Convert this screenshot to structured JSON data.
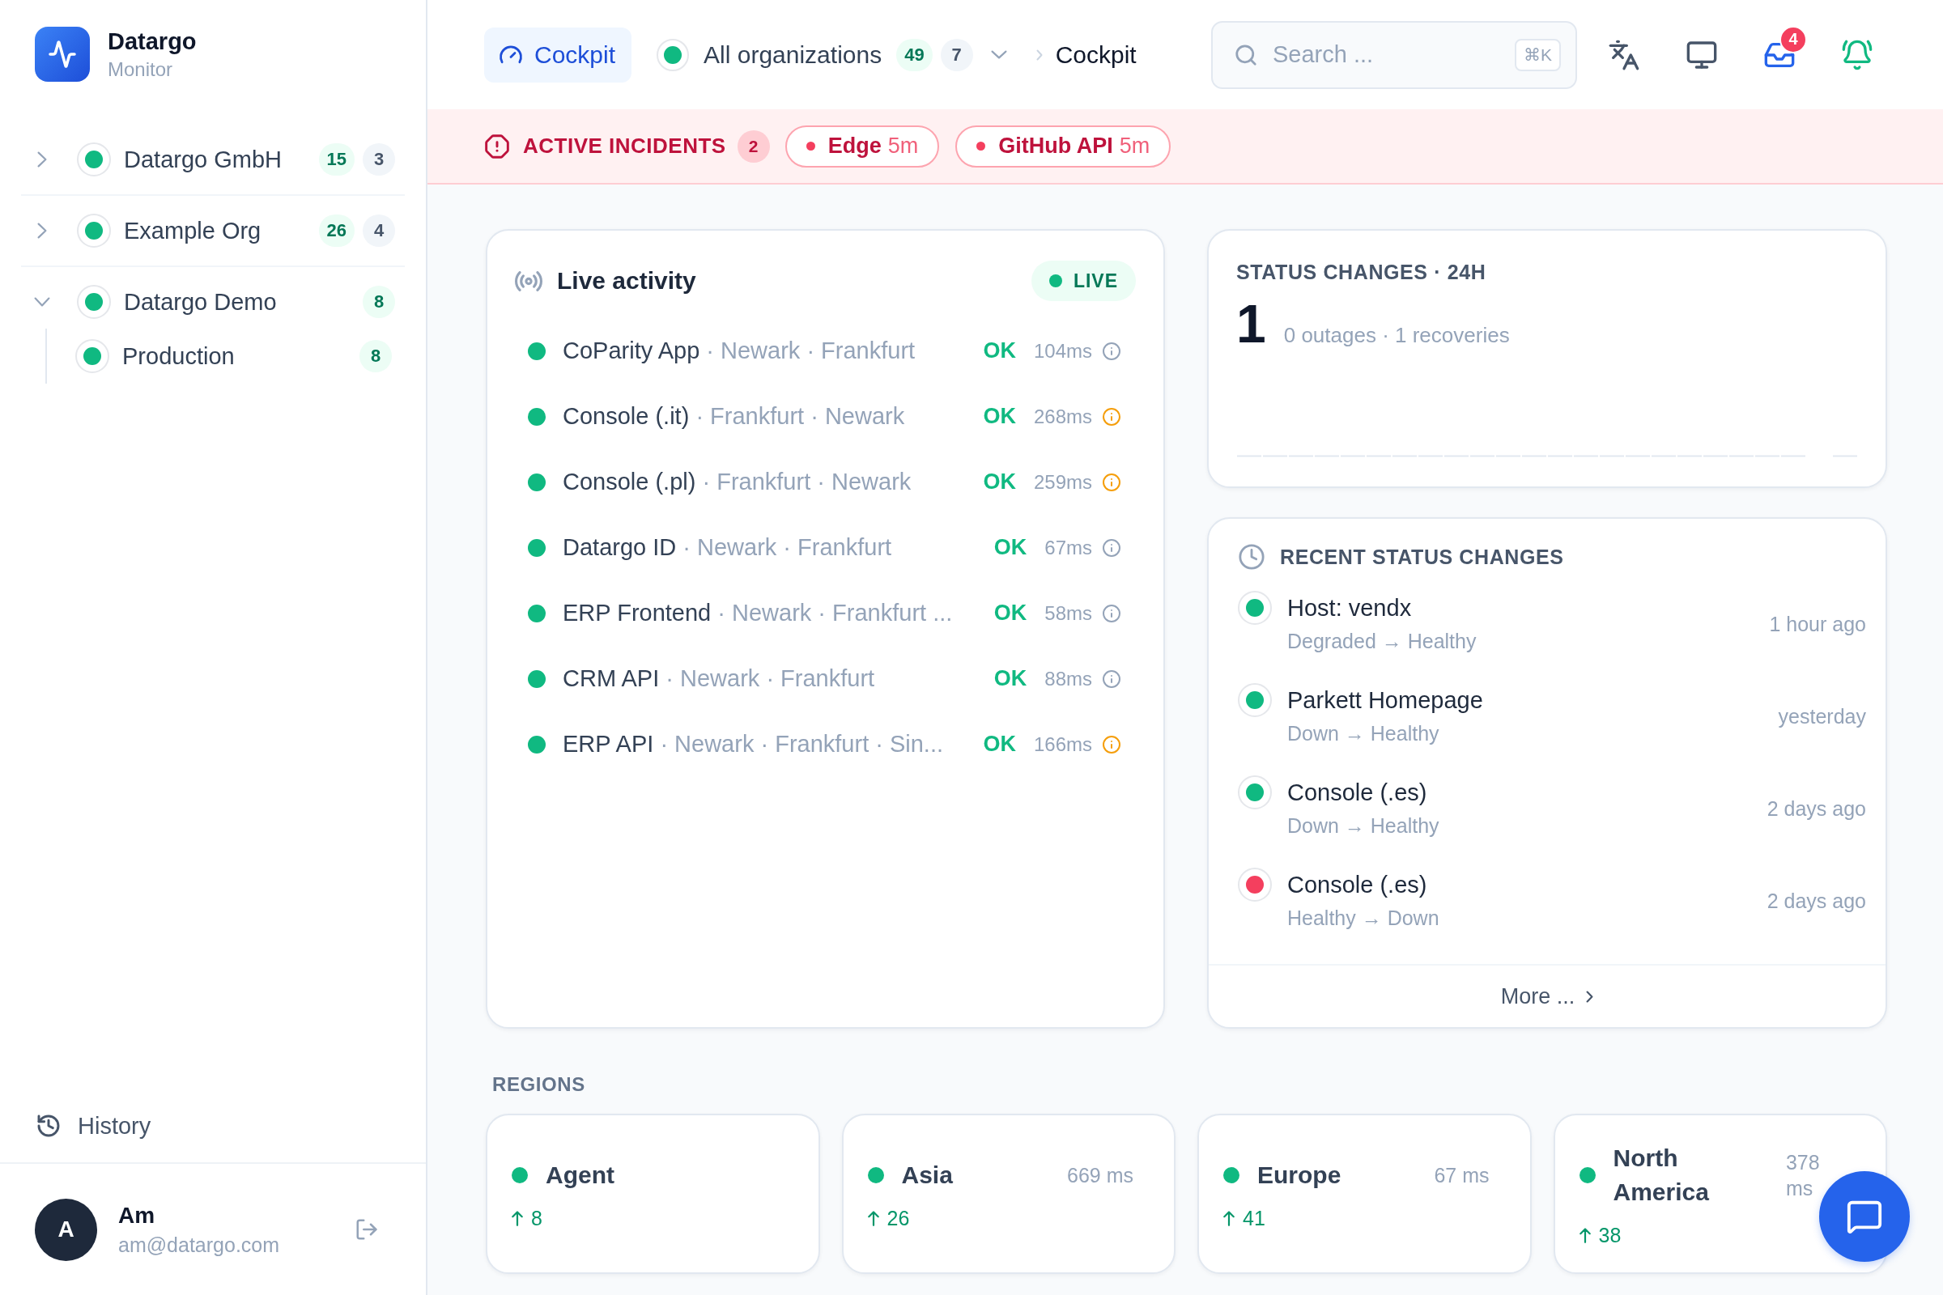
{
  "sidebar": {
    "brand": {
      "name": "Datargo",
      "subtitle": "Monitor"
    },
    "tree": [
      {
        "name": "Datargo GmbH",
        "healthy": true,
        "expanded": false,
        "badges": [
          {
            "text": "15",
            "kind": "up"
          },
          {
            "text": "3",
            "kind": "neutral"
          }
        ]
      },
      {
        "name": "Example Org",
        "healthy": true,
        "expanded": false,
        "badges": [
          {
            "text": "26",
            "kind": "up"
          },
          {
            "text": "4",
            "kind": "neutral"
          }
        ]
      },
      {
        "name": "Datargo Demo",
        "healthy": true,
        "expanded": true,
        "badges": [
          {
            "text": "8",
            "kind": "up"
          }
        ],
        "children": [
          {
            "name": "Production",
            "healthy": true,
            "badges": [
              {
                "text": "8",
                "kind": "up"
              }
            ]
          }
        ]
      }
    ],
    "history": {
      "label": "History"
    },
    "user": {
      "initial": "A",
      "name": "Am",
      "email": "am@datargo.com"
    }
  },
  "topbar": {
    "nav": {
      "label": "Cockpit",
      "selected": true
    },
    "org_selector": {
      "healthy": true,
      "label": "All organizations",
      "badges": [
        {
          "text": "49",
          "kind": "up"
        },
        {
          "text": "7",
          "kind": "neutral"
        }
      ]
    },
    "breadcrumb": "Cockpit",
    "search": {
      "placeholder": "Search ...",
      "shortcut": "⌘K"
    },
    "inbox": {
      "count": "4"
    },
    "alerts": {
      "on": true
    }
  },
  "incidents": {
    "title": "ACTIVE INCIDENTS",
    "count": "2",
    "items": [
      {
        "healthy": false,
        "name": "Edge",
        "age": "5m"
      },
      {
        "healthy": false,
        "name": "GitHub API",
        "age": "5m"
      }
    ]
  },
  "live_activity": {
    "title": "Live activity",
    "badge": "LIVE",
    "rows": [
      {
        "healthy": true,
        "name": "CoParity App",
        "route": "· Newark · Frankfurt",
        "result": "OK",
        "latency": "104ms",
        "warning": false
      },
      {
        "healthy": true,
        "name": "Console (.it)",
        "route": "· Frankfurt · Newark",
        "result": "OK",
        "latency": "268ms",
        "warning": true
      },
      {
        "healthy": true,
        "name": "Console (.pl)",
        "route": "· Frankfurt · Newark",
        "result": "OK",
        "latency": "259ms",
        "warning": true
      },
      {
        "healthy": true,
        "name": "Datargo ID",
        "route": "· Newark · Frankfurt",
        "result": "OK",
        "latency": "67ms",
        "warning": false
      },
      {
        "healthy": true,
        "name": "ERP Frontend",
        "route": "· Newark · Frankfurt ...",
        "result": "OK",
        "latency": "58ms",
        "warning": false
      },
      {
        "healthy": true,
        "name": "CRM API",
        "route": "· Newark · Frankfurt",
        "result": "OK",
        "latency": "88ms",
        "warning": false
      },
      {
        "healthy": true,
        "name": "ERP API",
        "route": "· Newark · Frankfurt · Sin...",
        "result": "OK",
        "latency": "166ms",
        "warning": true
      }
    ]
  },
  "status_changes_24h": {
    "title": "STATUS CHANGES · 24H",
    "total": "1",
    "summary": "0 outages · 1 recoveries"
  },
  "recent_changes": {
    "title": "RECENT STATUS CHANGES",
    "items": [
      {
        "color": "#10b981",
        "name": "Host: vendx",
        "transition": "Degraded → Healthy",
        "time": "1 hour ago"
      },
      {
        "color": "#10b981",
        "name": "Parkett Homepage",
        "transition": "Down → Healthy",
        "time": "yesterday"
      },
      {
        "color": "#10b981",
        "name": "Console (.es)",
        "transition": "Down → Healthy",
        "time": "2 days ago"
      },
      {
        "color": "#f43f5e",
        "name": "Console (.es)",
        "transition": "Healthy → Down",
        "time": "2 days ago"
      }
    ],
    "more": "More ..."
  },
  "regions": {
    "title": "REGIONS",
    "items": [
      {
        "healthy": true,
        "name": "Agent",
        "up": "8"
      },
      {
        "healthy": true,
        "name": "Asia",
        "latency": "669 ms",
        "up": "26"
      },
      {
        "healthy": true,
        "name": "Europe",
        "latency": "67 ms",
        "up": "41"
      },
      {
        "healthy": true,
        "name": "North America",
        "latency": "378 ms",
        "up": "38"
      }
    ]
  }
}
